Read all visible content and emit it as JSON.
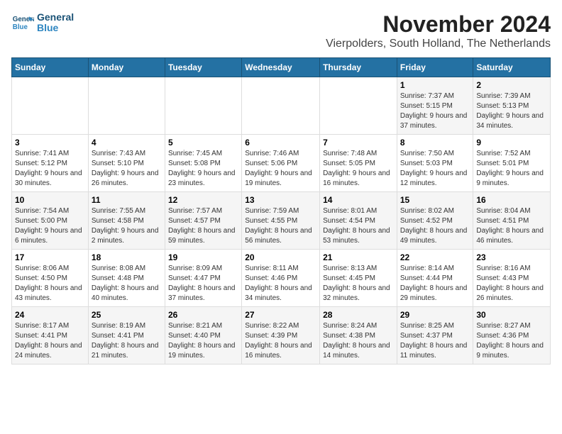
{
  "logo": {
    "line1": "General",
    "line2": "Blue"
  },
  "header": {
    "title": "November 2024",
    "subtitle": "Vierpolders, South Holland, The Netherlands"
  },
  "weekdays": [
    "Sunday",
    "Monday",
    "Tuesday",
    "Wednesday",
    "Thursday",
    "Friday",
    "Saturday"
  ],
  "weeks": [
    [
      {
        "day": "",
        "sunrise": "",
        "sunset": "",
        "daylight": ""
      },
      {
        "day": "",
        "sunrise": "",
        "sunset": "",
        "daylight": ""
      },
      {
        "day": "",
        "sunrise": "",
        "sunset": "",
        "daylight": ""
      },
      {
        "day": "",
        "sunrise": "",
        "sunset": "",
        "daylight": ""
      },
      {
        "day": "",
        "sunrise": "",
        "sunset": "",
        "daylight": ""
      },
      {
        "day": "1",
        "sunrise": "Sunrise: 7:37 AM",
        "sunset": "Sunset: 5:15 PM",
        "daylight": "Daylight: 9 hours and 37 minutes."
      },
      {
        "day": "2",
        "sunrise": "Sunrise: 7:39 AM",
        "sunset": "Sunset: 5:13 PM",
        "daylight": "Daylight: 9 hours and 34 minutes."
      }
    ],
    [
      {
        "day": "3",
        "sunrise": "Sunrise: 7:41 AM",
        "sunset": "Sunset: 5:12 PM",
        "daylight": "Daylight: 9 hours and 30 minutes."
      },
      {
        "day": "4",
        "sunrise": "Sunrise: 7:43 AM",
        "sunset": "Sunset: 5:10 PM",
        "daylight": "Daylight: 9 hours and 26 minutes."
      },
      {
        "day": "5",
        "sunrise": "Sunrise: 7:45 AM",
        "sunset": "Sunset: 5:08 PM",
        "daylight": "Daylight: 9 hours and 23 minutes."
      },
      {
        "day": "6",
        "sunrise": "Sunrise: 7:46 AM",
        "sunset": "Sunset: 5:06 PM",
        "daylight": "Daylight: 9 hours and 19 minutes."
      },
      {
        "day": "7",
        "sunrise": "Sunrise: 7:48 AM",
        "sunset": "Sunset: 5:05 PM",
        "daylight": "Daylight: 9 hours and 16 minutes."
      },
      {
        "day": "8",
        "sunrise": "Sunrise: 7:50 AM",
        "sunset": "Sunset: 5:03 PM",
        "daylight": "Daylight: 9 hours and 12 minutes."
      },
      {
        "day": "9",
        "sunrise": "Sunrise: 7:52 AM",
        "sunset": "Sunset: 5:01 PM",
        "daylight": "Daylight: 9 hours and 9 minutes."
      }
    ],
    [
      {
        "day": "10",
        "sunrise": "Sunrise: 7:54 AM",
        "sunset": "Sunset: 5:00 PM",
        "daylight": "Daylight: 9 hours and 6 minutes."
      },
      {
        "day": "11",
        "sunrise": "Sunrise: 7:55 AM",
        "sunset": "Sunset: 4:58 PM",
        "daylight": "Daylight: 9 hours and 2 minutes."
      },
      {
        "day": "12",
        "sunrise": "Sunrise: 7:57 AM",
        "sunset": "Sunset: 4:57 PM",
        "daylight": "Daylight: 8 hours and 59 minutes."
      },
      {
        "day": "13",
        "sunrise": "Sunrise: 7:59 AM",
        "sunset": "Sunset: 4:55 PM",
        "daylight": "Daylight: 8 hours and 56 minutes."
      },
      {
        "day": "14",
        "sunrise": "Sunrise: 8:01 AM",
        "sunset": "Sunset: 4:54 PM",
        "daylight": "Daylight: 8 hours and 53 minutes."
      },
      {
        "day": "15",
        "sunrise": "Sunrise: 8:02 AM",
        "sunset": "Sunset: 4:52 PM",
        "daylight": "Daylight: 8 hours and 49 minutes."
      },
      {
        "day": "16",
        "sunrise": "Sunrise: 8:04 AM",
        "sunset": "Sunset: 4:51 PM",
        "daylight": "Daylight: 8 hours and 46 minutes."
      }
    ],
    [
      {
        "day": "17",
        "sunrise": "Sunrise: 8:06 AM",
        "sunset": "Sunset: 4:50 PM",
        "daylight": "Daylight: 8 hours and 43 minutes."
      },
      {
        "day": "18",
        "sunrise": "Sunrise: 8:08 AM",
        "sunset": "Sunset: 4:48 PM",
        "daylight": "Daylight: 8 hours and 40 minutes."
      },
      {
        "day": "19",
        "sunrise": "Sunrise: 8:09 AM",
        "sunset": "Sunset: 4:47 PM",
        "daylight": "Daylight: 8 hours and 37 minutes."
      },
      {
        "day": "20",
        "sunrise": "Sunrise: 8:11 AM",
        "sunset": "Sunset: 4:46 PM",
        "daylight": "Daylight: 8 hours and 34 minutes."
      },
      {
        "day": "21",
        "sunrise": "Sunrise: 8:13 AM",
        "sunset": "Sunset: 4:45 PM",
        "daylight": "Daylight: 8 hours and 32 minutes."
      },
      {
        "day": "22",
        "sunrise": "Sunrise: 8:14 AM",
        "sunset": "Sunset: 4:44 PM",
        "daylight": "Daylight: 8 hours and 29 minutes."
      },
      {
        "day": "23",
        "sunrise": "Sunrise: 8:16 AM",
        "sunset": "Sunset: 4:43 PM",
        "daylight": "Daylight: 8 hours and 26 minutes."
      }
    ],
    [
      {
        "day": "24",
        "sunrise": "Sunrise: 8:17 AM",
        "sunset": "Sunset: 4:41 PM",
        "daylight": "Daylight: 8 hours and 24 minutes."
      },
      {
        "day": "25",
        "sunrise": "Sunrise: 8:19 AM",
        "sunset": "Sunset: 4:41 PM",
        "daylight": "Daylight: 8 hours and 21 minutes."
      },
      {
        "day": "26",
        "sunrise": "Sunrise: 8:21 AM",
        "sunset": "Sunset: 4:40 PM",
        "daylight": "Daylight: 8 hours and 19 minutes."
      },
      {
        "day": "27",
        "sunrise": "Sunrise: 8:22 AM",
        "sunset": "Sunset: 4:39 PM",
        "daylight": "Daylight: 8 hours and 16 minutes."
      },
      {
        "day": "28",
        "sunrise": "Sunrise: 8:24 AM",
        "sunset": "Sunset: 4:38 PM",
        "daylight": "Daylight: 8 hours and 14 minutes."
      },
      {
        "day": "29",
        "sunrise": "Sunrise: 8:25 AM",
        "sunset": "Sunset: 4:37 PM",
        "daylight": "Daylight: 8 hours and 11 minutes."
      },
      {
        "day": "30",
        "sunrise": "Sunrise: 8:27 AM",
        "sunset": "Sunset: 4:36 PM",
        "daylight": "Daylight: 8 hours and 9 minutes."
      }
    ]
  ]
}
